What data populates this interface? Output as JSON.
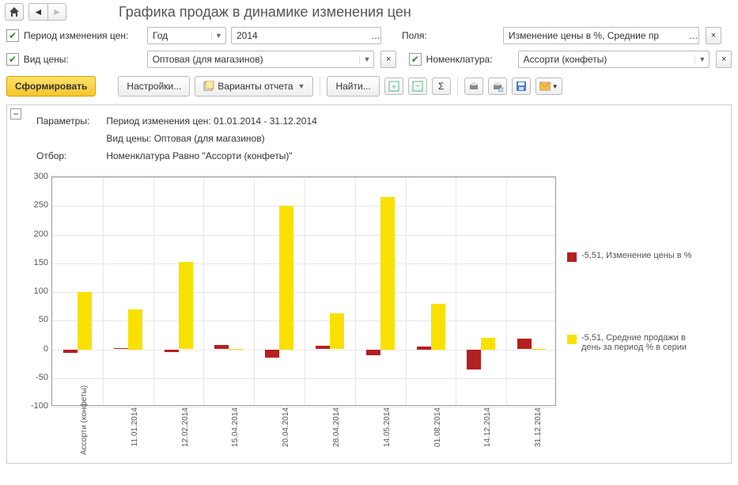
{
  "header": {
    "title": "Графика продаж в динамике изменения цен",
    "home_icon": "home-icon",
    "back_icon": "◄",
    "fwd_icon": "►"
  },
  "filters": {
    "period_label": "Период изменения цен:",
    "period_unit": "Год",
    "period_value": "2014",
    "fields_label": "Поля:",
    "fields_value": "Изменение цены в %, Средние пр",
    "price_type_label": "Вид цены:",
    "price_type_value": "Оптовая (для магазинов)",
    "nomen_label": "Номенклатура:",
    "nomen_value": "Ассорти (конфеты)"
  },
  "toolbar": {
    "generate": "Сформировать",
    "settings": "Настройки...",
    "report_variants": "Варианты отчета",
    "find": "Найти...",
    "sigma": "Σ"
  },
  "report": {
    "params_label": "Параметры:",
    "params_line1": "Период изменения цен: 01.01.2014 - 31.12.2014",
    "params_line2": "Вид цены: Оптовая (для магазинов)",
    "filter_label": "Отбор:",
    "filter_line": "Номенклатура Равно \"Ассорти (конфеты)\""
  },
  "legend": {
    "series1": "-5,51, Изменение цены в %",
    "series2": "-5,51, Средние продажи в день за период % в серии"
  },
  "chart_data": {
    "type": "bar",
    "ylim": [
      -100,
      300
    ],
    "yticks": [
      -100,
      -50,
      0,
      50,
      100,
      150,
      200,
      250,
      300
    ],
    "categories": [
      "Ассорти (конфеты)",
      "11.01.2014",
      "12.02.2014",
      "15.04.2014",
      "20.04.2014",
      "28.04.2014",
      "14.05.2014",
      "01.08.2014",
      "14.12.2014",
      "31.12.2014"
    ],
    "series": [
      {
        "name": "Изменение цены в %",
        "color": "red",
        "values": [
          -6,
          2,
          -5,
          7,
          -15,
          6,
          -10,
          5,
          -35,
          18
        ]
      },
      {
        "name": "Средние продажи в день за период % в серии",
        "color": "yellow",
        "values": [
          100,
          70,
          152,
          1,
          250,
          63,
          265,
          80,
          20,
          1
        ]
      }
    ]
  }
}
